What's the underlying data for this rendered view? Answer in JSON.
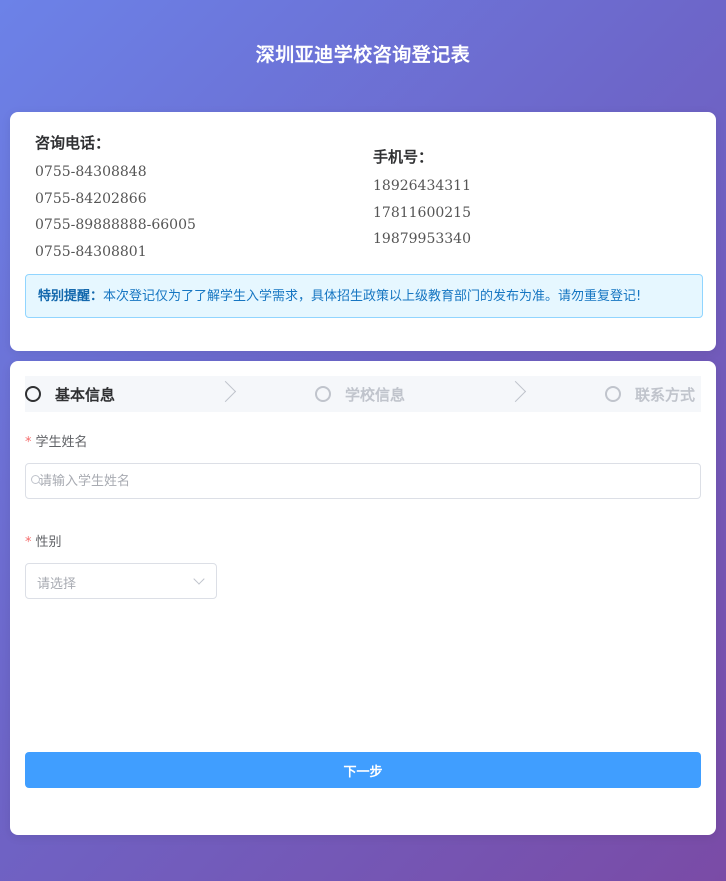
{
  "header": {
    "title": "深圳亚迪学校咨询登记表"
  },
  "contact": {
    "phone_heading": "咨询电话：",
    "phones": [
      "0755-84308848",
      "0755-84202866",
      "0755-89888888-66005",
      "0755-84308801"
    ],
    "mobile_heading": "手机号：",
    "mobiles": [
      "18926434311",
      "17811600215",
      "19879953340"
    ]
  },
  "notice": {
    "label": "特别提醒：",
    "text": "本次登记仅为了了解学生入学需求，具体招生政策以上级教育部门的发布为准。请勿重复登记!"
  },
  "steps": [
    {
      "label": "基本信息",
      "state": "active"
    },
    {
      "label": "学校信息",
      "state": "inactive"
    },
    {
      "label": "联系方式",
      "state": "inactive"
    }
  ],
  "form": {
    "required_mark": "*",
    "name_label": "学生姓名",
    "name_placeholder": "请输入学生姓名",
    "name_value": "",
    "gender_label": "性别",
    "gender_placeholder": "请选择",
    "next_button": "下一步"
  },
  "colors": {
    "primary": "#409eff",
    "notice_bg": "#e6f7ff",
    "notice_text": "#1676c2",
    "required": "#f56c6c"
  },
  "icons": {
    "name_prefix": "search-icon",
    "select_suffix": "chevron-down-icon",
    "step_separator": "chevron-right-icon"
  }
}
